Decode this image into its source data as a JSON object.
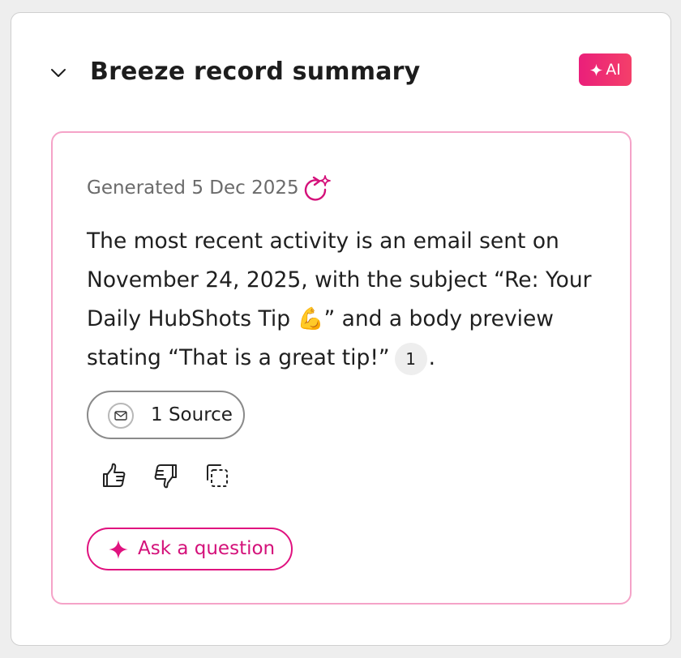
{
  "card": {
    "title": "Breeze record summary",
    "badge": "AI"
  },
  "summary": {
    "generated": "Generated 5 Dec 2025",
    "text_before": "The most recent activity is an email sent on November 24, 2025, with the subject “Re: Your Daily HubShots Tip 💪” and a body preview stating “That is a great tip!”",
    "citation": "1",
    "text_after": ".",
    "source_label": "1 Source",
    "ask_label": "Ask a question"
  },
  "icons": {
    "collapse": "chevron-down-icon",
    "badge": "sparkle-icon",
    "regenerate": "regenerate-sparkle-icon",
    "source": "mail-icon",
    "thumbs_up": "thumbs-up-icon",
    "thumbs_down": "thumbs-down-icon",
    "copy": "copy-icon",
    "ask": "sparkle-icon"
  },
  "colors": {
    "accent": "#e0127f",
    "badge_gradient_start": "#ea1f7a",
    "badge_gradient_end": "#f43f6a",
    "summary_border": "#f5a3c8"
  }
}
